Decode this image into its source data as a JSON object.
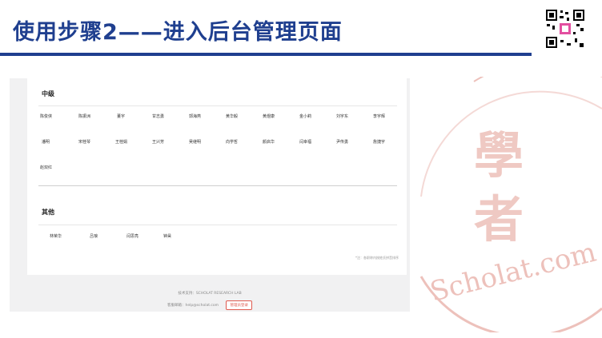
{
  "slide": {
    "title": "使用步骤2——进入后台管理页面"
  },
  "sections": [
    {
      "title": "中级",
      "rows": [
        [
          "陈俊侠",
          "陈振洲",
          "董宇",
          "甘志勇",
          "郭海燕",
          "黄华毅",
          "黄煜康",
          "金小莉",
          "刘宇东",
          "李宇辉"
        ],
        [
          "潘明",
          "宋桂琴",
          "王桂娟",
          "王兴芳",
          "吴继明",
          "向学哲",
          "颜启华",
          "闫幸福",
          "尹传勇",
          "詹捷宇"
        ],
        [
          "赵双红"
        ]
      ]
    },
    {
      "title": "其他",
      "rows": [
        [
          "林荣华",
          "吕琅",
          "闫思亮",
          "钟昊"
        ]
      ]
    }
  ],
  "note": "*注：各职称内按姓氏拼音排序",
  "footer": {
    "support": "技术支持：SCHOLAT RESEARCH LAB",
    "email": "客服邮箱：help@scholat.com",
    "admin_button": "管理员登录"
  },
  "watermark": {
    "chars": [
      "學",
      "者"
    ],
    "text": "Scholat.com",
    "color": "#e6a79f"
  },
  "colors": {
    "title": "#1f3f8f",
    "accent_red": "#e05a4f"
  }
}
